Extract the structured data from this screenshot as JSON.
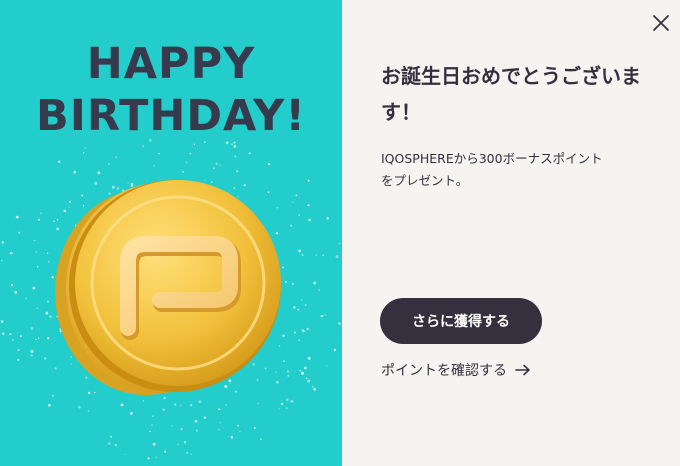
{
  "banner": {
    "title_line1": "HAPPY",
    "title_line2": "BIRTHDAY!",
    "coin_logo": "P",
    "background_color": "#23cdcb",
    "title_color": "#363a4c",
    "coin_color": "#f0bd3a"
  },
  "dialog": {
    "heading": "お誕生日おめでとうございます！",
    "description": "IQOSPHEREから300ボーナスポイントをプレゼント。",
    "primary_button_label": "さらに獲得する",
    "secondary_link_label": "ポイントを確認する",
    "secondary_link_icon": "arrow-right-icon",
    "close_icon": "close-icon",
    "background_color": "#f6f4f1",
    "button_color": "#34303d"
  }
}
